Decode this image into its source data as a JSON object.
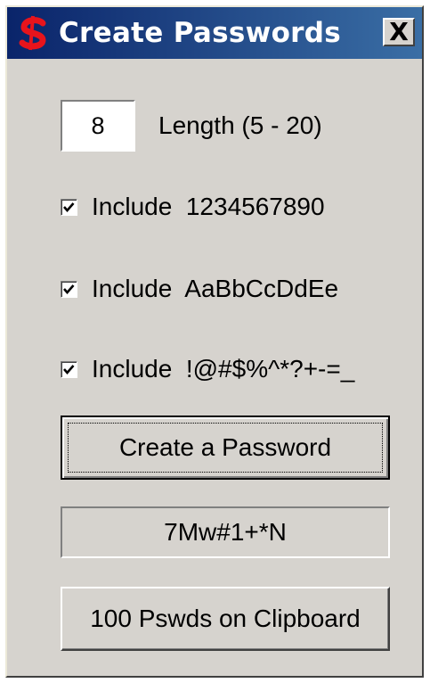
{
  "window": {
    "title": "Create Passwords",
    "close_label": "X",
    "icon": "dollar-s-icon"
  },
  "length": {
    "value": "8",
    "label": "Length (5 - 20)"
  },
  "options": [
    {
      "label": "Include  1234567890",
      "checked": true
    },
    {
      "label": "Include  AaBbCcDdEe",
      "checked": true
    },
    {
      "label": "Include  !@#$%^*?+-=_",
      "checked": true
    }
  ],
  "buttons": {
    "create_label": "Create a Password",
    "clipboard_label": "100 Pswds on Clipboard"
  },
  "output": {
    "password": "7Mw#1+*N"
  },
  "colors": {
    "titlebar_start": "#0a246a",
    "titlebar_end": "#3a6ea5",
    "icon_red": "#e8141c",
    "face": "#d6d3ce"
  }
}
